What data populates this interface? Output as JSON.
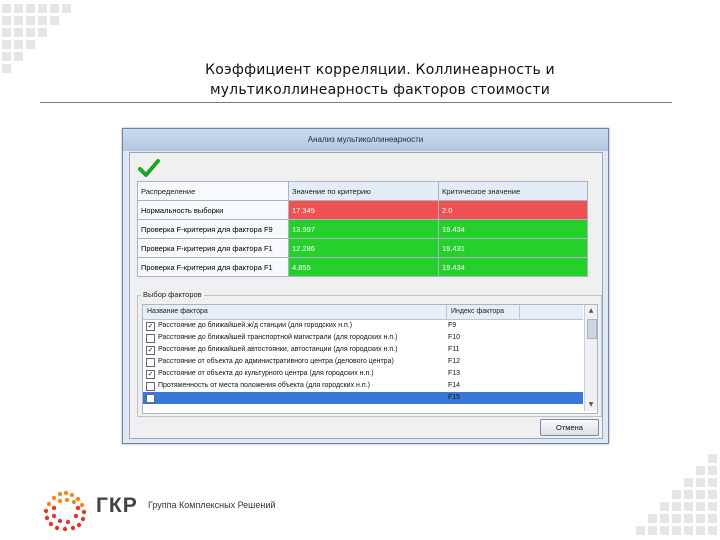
{
  "slide": {
    "title_line1": "Коэффициент корреляции. Коллинеарность и",
    "title_line2": "мультиколлинеарность факторов стоимости"
  },
  "window": {
    "title": "Анализ мультиколлинеарности",
    "status_icon": "green-checkmark-icon",
    "table": {
      "headers": [
        "Распределение",
        "Значение по критерию",
        "Критическое значение"
      ],
      "rows": [
        {
          "name": "Нормальность выборки",
          "value": "17.345",
          "critical": "2.0",
          "status": "red"
        },
        {
          "name": "Проверка F-критерия для фактора F9",
          "value": "13.997",
          "critical": "19.434",
          "status": "green"
        },
        {
          "name": "Проверка F-критерия для фактора F1",
          "value": "12.286",
          "critical": "19.431",
          "status": "green"
        },
        {
          "name": "Проверка F-критерия для фактора F1",
          "value": "4.855",
          "critical": "19.434",
          "status": "green"
        }
      ]
    },
    "factors": {
      "legend": "Выбор факторов",
      "headers": [
        "Название фактора",
        "Индекс фактора"
      ],
      "rows": [
        {
          "checked": true,
          "name": "Расстояние до ближайшей ж/д станции (для городских н.п.)",
          "code": "F9"
        },
        {
          "checked": false,
          "name": "Расстояние до ближайшей транспортной магистрали (для городских н.п.)",
          "code": "F10"
        },
        {
          "checked": true,
          "name": "Расстояние до ближайшей автостоянки, автостанции (для городских н.п.)",
          "code": "F11"
        },
        {
          "checked": false,
          "name": "Расстояние от объекта до административного центра (делового центра)",
          "code": "F12"
        },
        {
          "checked": true,
          "name": "Расстояние от объекта до культурного центра (для городских н.п.)",
          "code": "F13"
        },
        {
          "checked": false,
          "name": "Протяженность от места положения объекта (для городских н.п.)",
          "code": "F14"
        },
        {
          "checked": false,
          "name": "",
          "code": "F15",
          "selected": true
        }
      ]
    },
    "cancel_label": "Отмена"
  },
  "brand": {
    "logo_icon": "gkr-dotted-logo-icon",
    "name": "ГКР",
    "subtitle": "Группа Комплексных Решений",
    "colors": {
      "orange": "#f08a1c",
      "red": "#e0392b",
      "green": "#26d02c",
      "red_cell": "#ee5252"
    }
  }
}
